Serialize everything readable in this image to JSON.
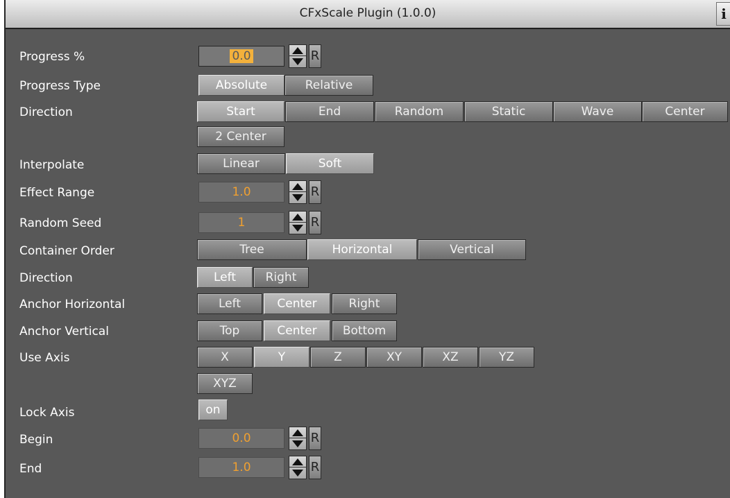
{
  "window": {
    "title": "CFxScale Plugin (1.0.0)",
    "info_label": "i"
  },
  "params": {
    "progress": {
      "label": "Progress %",
      "value": "0.0",
      "reset": "R"
    },
    "progress_type": {
      "label": "Progress Type",
      "options": [
        "Absolute",
        "Relative"
      ],
      "selected": "Absolute"
    },
    "direction": {
      "label": "Direction",
      "options": [
        "Start",
        "End",
        "Random",
        "Static",
        "Wave",
        "Center",
        "2 Center"
      ],
      "selected": "Start"
    },
    "interpolate": {
      "label": "Interpolate",
      "options": [
        "Linear",
        "Soft"
      ],
      "selected": "Soft"
    },
    "effect_range": {
      "label": "Effect Range",
      "value": "1.0",
      "reset": "R"
    },
    "random_seed": {
      "label": "Random Seed",
      "value": "1",
      "reset": "R"
    },
    "container_order": {
      "label": "Container Order",
      "options": [
        "Tree",
        "Horizontal",
        "Vertical"
      ],
      "selected": "Horizontal"
    },
    "direction2": {
      "label": "Direction",
      "options": [
        "Left",
        "Right"
      ],
      "selected": "Left"
    },
    "anchor_horizontal": {
      "label": "Anchor Horizontal",
      "options": [
        "Left",
        "Center",
        "Right"
      ],
      "selected": "Center"
    },
    "anchor_vertical": {
      "label": "Anchor Vertical",
      "options": [
        "Top",
        "Center",
        "Bottom"
      ],
      "selected": "Center"
    },
    "use_axis": {
      "label": "Use Axis",
      "options": [
        "X",
        "Y",
        "Z",
        "XY",
        "XZ",
        "YZ",
        "XYZ"
      ],
      "selected": "Y"
    },
    "lock_axis": {
      "label": "Lock Axis",
      "toggle_label": "on"
    },
    "begin": {
      "label": "Begin",
      "value": "0.0",
      "reset": "R"
    },
    "end": {
      "label": "End",
      "value": "1.0",
      "reset": "R"
    }
  }
}
